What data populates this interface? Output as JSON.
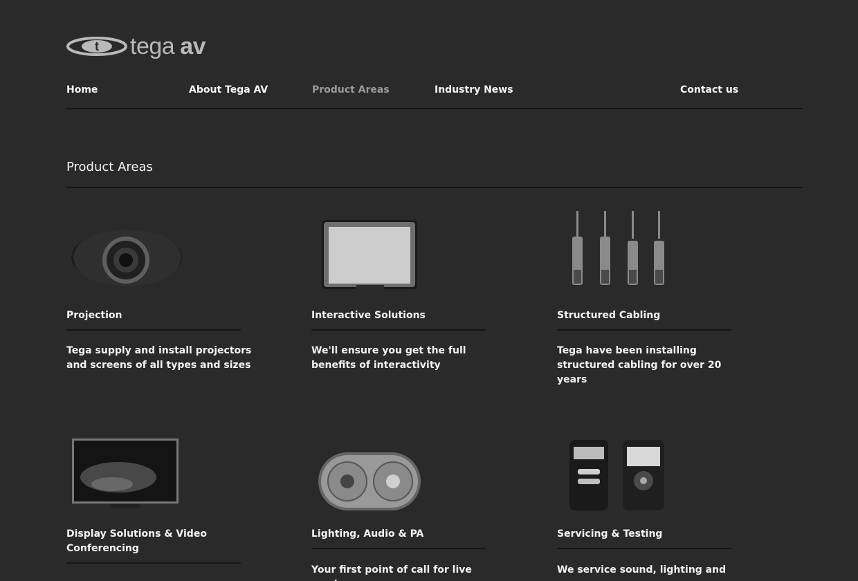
{
  "logo": {
    "text_light": "tega",
    "text_bold": "av"
  },
  "nav": {
    "items": [
      {
        "label": "Home",
        "active": false
      },
      {
        "label": "About Tega AV",
        "active": false
      },
      {
        "label": "Product Areas",
        "active": true
      },
      {
        "label": "Industry News",
        "active": false
      },
      {
        "label": "Contact us",
        "active": false
      }
    ]
  },
  "page": {
    "title": "Product Areas"
  },
  "products": [
    {
      "name": "Projection",
      "description": "Tega supply and install projectors and screens of all types and sizes",
      "image": "projector-image"
    },
    {
      "name": "Interactive Solutions",
      "description": "We'll ensure you get the full benefits of interactivity",
      "image": "interactive-whiteboard-image"
    },
    {
      "name": "Structured Cabling",
      "description": "Tega have been installing structured cabling for over 20 years",
      "image": "network-cables-image"
    },
    {
      "name": "Display Solutions & Video Conferencing",
      "description": "",
      "image": "display-monitor-image"
    },
    {
      "name": "Lighting, Audio & PA",
      "description": "Your first point of call for live music",
      "image": "speaker-image"
    },
    {
      "name": "Servicing & Testing",
      "description": "We service sound, lighting and",
      "image": "audio-testers-image"
    }
  ]
}
